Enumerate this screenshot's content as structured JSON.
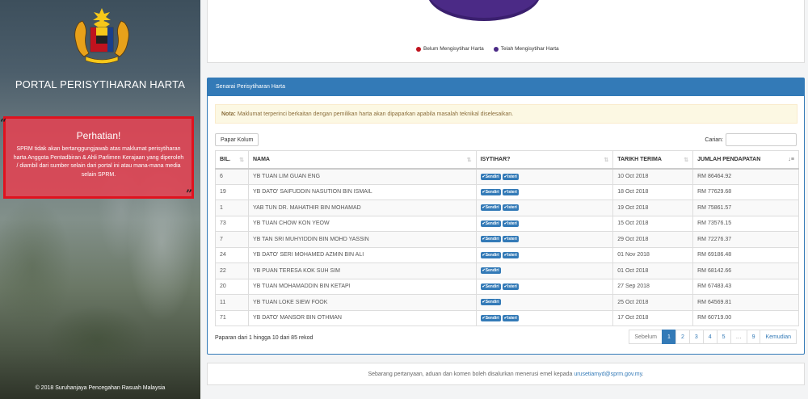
{
  "sidebar": {
    "portal_title": "PORTAL PERISYTIHARAN HARTA",
    "alert_title": "Perhatian!",
    "alert_text": "SPRM tidak akan bertanggungjawab atas maklumat perisytiharan harta Anggota Pentadbiran & Ahli Parlimen Kerajaan yang diperoleh / diambil dari sumber selain dari portal ini atau mana-mana media selain SPRM.",
    "quote_open": "“",
    "quote_close": "”",
    "copyright": "© 2018 Suruhanjaya Pencegahan Rasuah Malaysia"
  },
  "chart": {
    "legend": [
      {
        "label": "Belum Mengisytihar Harta",
        "color": "#c0131e"
      },
      {
        "label": "Telah Mengisytihar Harta",
        "color": "#4b2a86"
      }
    ]
  },
  "list": {
    "heading": "Senarai Perisytiharan Harta",
    "note_label": "Nota:",
    "note_text": " Maklumat terperinci berkaitan dengan pemilikan harta akan dipaparkan apabila masalah teknikal diselesaikan.",
    "column_button": "Papar Kolum",
    "search_label": "Carian:",
    "search_value": "",
    "columns": [
      "BIL.",
      "NAMA",
      "ISYTIHAR?",
      "TARIKH TERIMA",
      "JUMLAH PENDAPATAN"
    ],
    "badge_sendiri": "Sendiri",
    "badge_isteri": "Isteri",
    "rows": [
      {
        "bil": "6",
        "nama": "YB TUAN LIM GUAN ENG",
        "isteri": true,
        "tarikh": "10 Oct 2018",
        "jumlah": "RM 86464.92"
      },
      {
        "bil": "19",
        "nama": "YB DATO' SAIFUDDIN NASUTION BIN ISMAIL",
        "isteri": true,
        "tarikh": "18 Oct 2018",
        "jumlah": "RM 77629.68"
      },
      {
        "bil": "1",
        "nama": "YAB TUN DR. MAHATHIR BIN MOHAMAD",
        "isteri": true,
        "tarikh": "19 Oct 2018",
        "jumlah": "RM 75861.57"
      },
      {
        "bil": "73",
        "nama": "YB TUAN CHOW KON YEOW",
        "isteri": true,
        "tarikh": "15 Oct 2018",
        "jumlah": "RM 73576.15"
      },
      {
        "bil": "7",
        "nama": "YB TAN SRI MUHYIDDIN BIN MOHD YASSIN",
        "isteri": true,
        "tarikh": "29 Oct 2018",
        "jumlah": "RM 72276.37"
      },
      {
        "bil": "24",
        "nama": "YB DATO' SERI MOHAMED AZMIN BIN ALI",
        "isteri": true,
        "tarikh": "01 Nov 2018",
        "jumlah": "RM 69186.48"
      },
      {
        "bil": "22",
        "nama": "YB PUAN TERESA KOK SUH SIM",
        "isteri": false,
        "tarikh": "01 Oct 2018",
        "jumlah": "RM 68142.66"
      },
      {
        "bil": "20",
        "nama": "YB TUAN MOHAMADDIN BIN KETAPI",
        "isteri": true,
        "tarikh": "27 Sep 2018",
        "jumlah": "RM 67483.43"
      },
      {
        "bil": "11",
        "nama": "YB TUAN LOKE SIEW FOOK",
        "isteri": false,
        "tarikh": "25 Oct 2018",
        "jumlah": "RM 64569.81"
      },
      {
        "bil": "71",
        "nama": "YB DATO' MANSOR BIN OTHMAN",
        "isteri": true,
        "tarikh": "17 Oct 2018",
        "jumlah": "RM 60719.00"
      }
    ],
    "info": "Paparan dari 1 hingga 10 dari 85 rekod",
    "pagination": {
      "prev": "Sebelum",
      "pages": [
        "1",
        "2",
        "3",
        "4",
        "5",
        "…",
        "9"
      ],
      "active": "1",
      "next": "Kemudian"
    }
  },
  "footer": {
    "text": "Sebarang pertanyaan, aduan dan komen boleh disalurkan menerusi emel kepada ",
    "email": "urusetiamyd@sprm.gov.my",
    "end": "."
  }
}
